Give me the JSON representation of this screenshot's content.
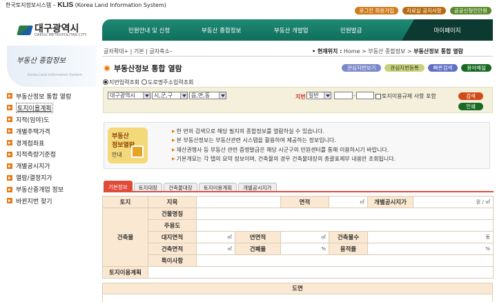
{
  "system": {
    "name_ko": "한국토지정보시스템 –",
    "name_en": "KLIS",
    "name_en_full": "(Korea Land Information System)"
  },
  "top_links": [
    "로그인 회원가입",
    "자료실 공지사항",
    "공공신청인안원"
  ],
  "logo": {
    "title": "대구광역시",
    "sub": "DAEGU METROPOLITAN CITY",
    "badge": "DAEGU"
  },
  "nav": [
    "민원안내 및 신청",
    "부동산 종합정보",
    "부동산 개발업",
    "민원발급"
  ],
  "nav_mypage": "마이페이지",
  "sidebar": {
    "title": "부동산 종합정보",
    "subtitle": "Korea Land Information System",
    "items": [
      "부동산정보 통합 열람",
      "토지이용계획",
      "지적(임야)도",
      "개별주택가격",
      "경계점좌표",
      "지적측량기준점",
      "개별공시지가",
      "열람/결정지가",
      "부동산중개업 정보",
      "바뀐지번 찾기"
    ]
  },
  "font_ctrl": "글자확대+ | 기본 | 글자축소–",
  "location": {
    "label": "• 현재위치 :",
    "path": "Home > 부동산 종합정보 >",
    "current": "부동산정보 통합 열람"
  },
  "page_title": "부동산정보 통합 열람",
  "page_buttons": [
    "관심지번보기",
    "관심지번등록",
    "빠른검색",
    "용어해설"
  ],
  "search": {
    "radio1": "지번입력조회",
    "radio2": "도로명주소입력조회",
    "city": "대구광역시",
    "district": "시,군,구",
    "town": "읍,면,동",
    "jibun_label": "지번",
    "jibun_type": "일반",
    "check_label": "토지이용규제 사항 포함",
    "search_btn": "검색",
    "print_btn": "인쇄"
  },
  "info": {
    "badge_line1": "부동산",
    "badge_line2": "정보열람",
    "badge_line3": "안내",
    "lines": [
      "한 번의 검색으로 해당 필지의 종합정보를 열람하실 수 있습니다.",
      "본 부동산정보는 부동산관련 시스템을 활용하여 제공하는 정보입니다.",
      "재산권행사 등 부동산 관련 증명발급은 해당 시군구의 민원센터를 통해 이용하시기 바랍니다.",
      "기본개요는 각 탭의 요약 정보이며, 건축물의 경우 건축물대장의 총괄표제부 내용만 조회됩니다."
    ]
  },
  "tabs": [
    "기본정보",
    "토지대장",
    "건축물대장",
    "토지이용계획",
    "개별공시지가"
  ],
  "table": {
    "land": "토지",
    "jimok": "지목",
    "area": "면적",
    "unit_m2": "㎡",
    "gongsi": "개별공시지가",
    "won_m2": "원 / ㎡",
    "building": "건축물",
    "bname": "건물명칭",
    "main_use": "주용도",
    "site_area": "대지면적",
    "floor_area": "연면적",
    "bcount": "건축물수",
    "dong": "동",
    "bldg_area": "건축면적",
    "bcr": "건폐율",
    "far": "용적률",
    "pct": "%",
    "special": "특이사항",
    "landuse": "토지이용계획"
  },
  "drawing": "도면"
}
